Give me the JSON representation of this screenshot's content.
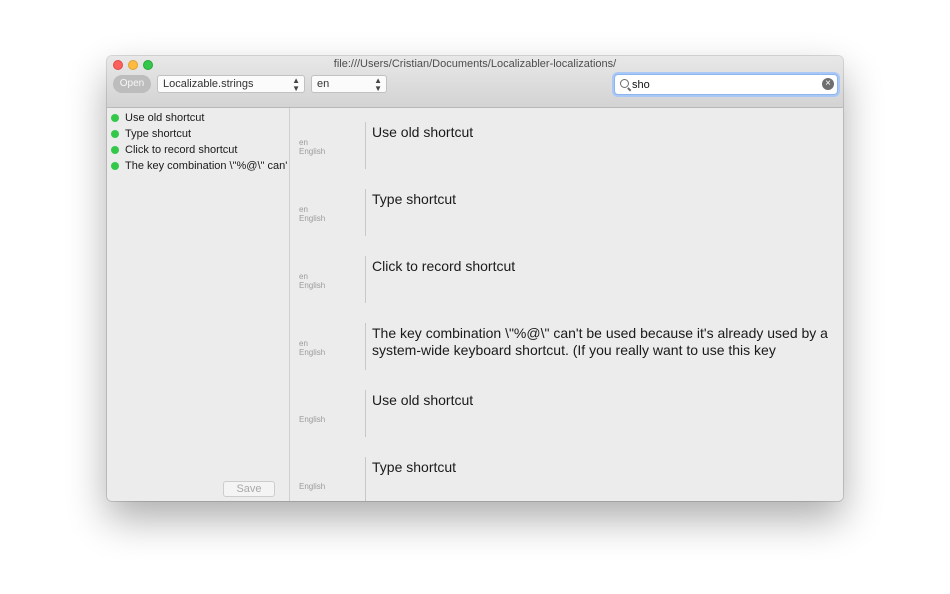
{
  "window": {
    "title": "file:///Users/Cristian/Documents/Localizabler-localizations/"
  },
  "toolbar": {
    "open_label": "Open",
    "file_popup": "Localizable.strings",
    "lang_popup": "en",
    "search_value": "sho",
    "search_icon": "magnifier",
    "clear_icon": "circle-x"
  },
  "colors": {
    "status_green": "#34c84a",
    "accent_blue": "#8bb6ee"
  },
  "sidebar": {
    "keys": [
      {
        "label": "Use old shortcut"
      },
      {
        "label": "Type shortcut"
      },
      {
        "label": "Click to record shortcut"
      },
      {
        "label": "The key combination \\\"%@\\\" can't..."
      }
    ],
    "save_label": "Save"
  },
  "translations": [
    {
      "code": "en",
      "language": "English",
      "text": "Use old shortcut"
    },
    {
      "code": "en",
      "language": "English",
      "text": "Type shortcut"
    },
    {
      "code": "en",
      "language": "English",
      "text": "Click to record shortcut"
    },
    {
      "code": "en",
      "language": "English",
      "text": "The key combination \\\"%@\\\" can't be used because it's already used by a system-wide keyboard shortcut. (If you really want to use this key"
    },
    {
      "code": "",
      "language": "English",
      "text": "Use old shortcut"
    },
    {
      "code": "",
      "language": "English",
      "text": "Type shortcut"
    }
  ]
}
